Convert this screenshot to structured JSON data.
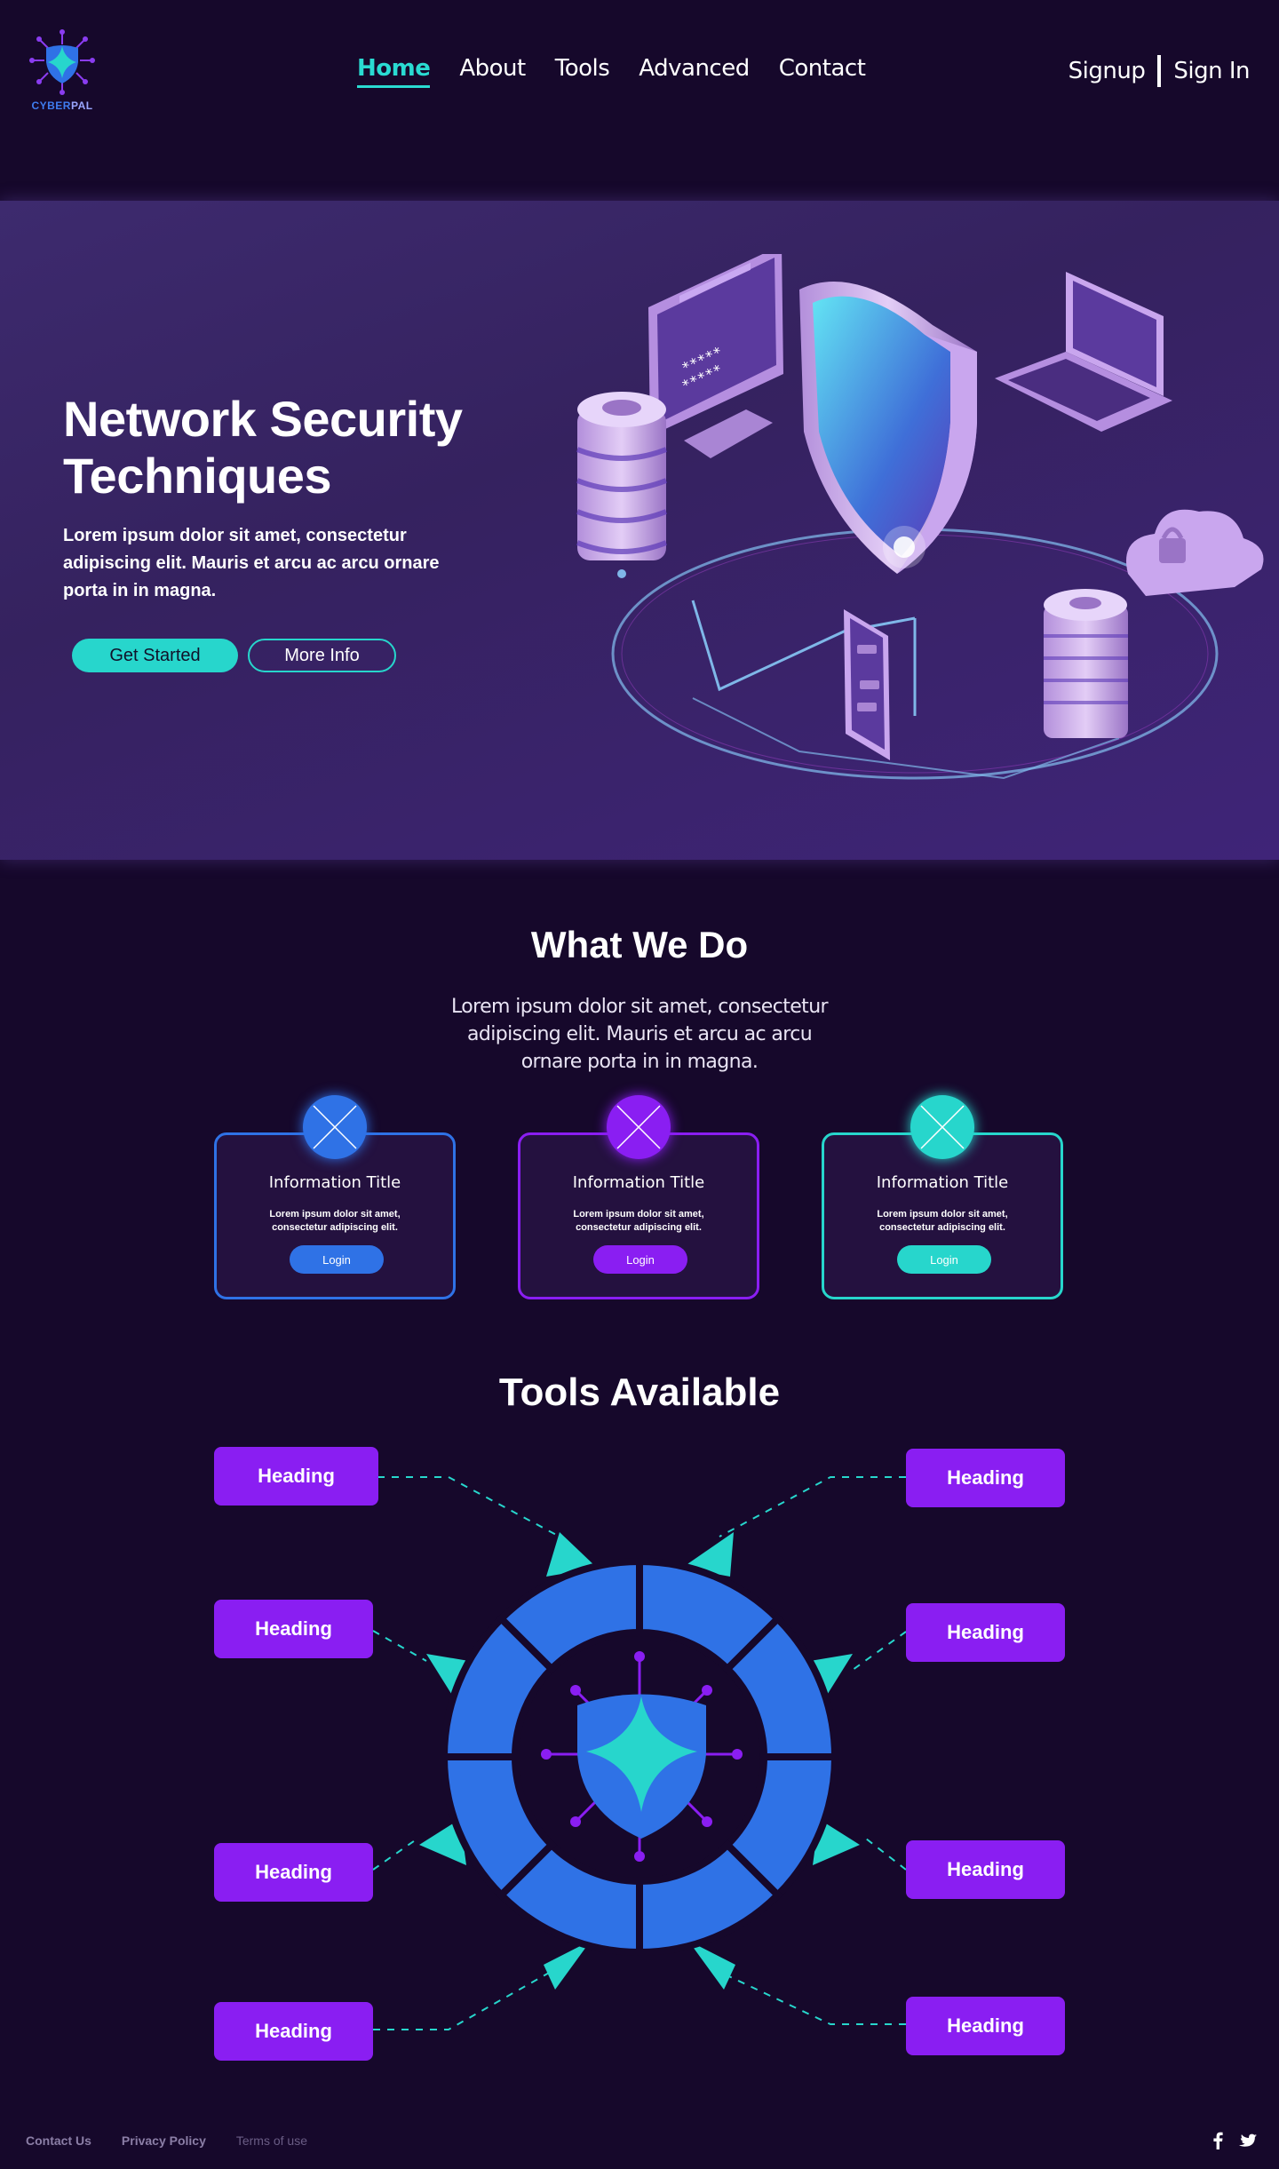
{
  "brand": {
    "logo_text_1": "CYBER",
    "logo_text_2": "PAL"
  },
  "nav": {
    "items": [
      "Home",
      "About",
      "Tools",
      "Advanced",
      "Contact"
    ],
    "active": "Home"
  },
  "auth": {
    "signup": "Signup",
    "signin": "Sign In"
  },
  "hero": {
    "title": "Network Security Techniques",
    "description": "Lorem ipsum dolor sit amet, consectetur adipiscing elit. Mauris et arcu ac arcu ornare porta in in magna.",
    "primary_button": "Get Started",
    "secondary_button": "More Info"
  },
  "what_we_do": {
    "title": "What We Do",
    "description": "Lorem ipsum dolor sit amet, consectetur adipiscing elit. Mauris et arcu ac arcu ornare porta in in magna.",
    "cards": [
      {
        "title": "Information Title",
        "text": "Lorem ipsum dolor sit amet, consectetur adipiscing elit.",
        "button": "Login",
        "color": "#2f72e6"
      },
      {
        "title": "Information Title",
        "text": "Lorem ipsum dolor sit amet, consectetur adipiscing elit.",
        "button": "Login",
        "color": "#8a1ef2"
      },
      {
        "title": "Information Title",
        "text": "Lorem ipsum dolor sit amet, consectetur adipiscing elit.",
        "button": "Login",
        "color": "#27d6cc"
      }
    ]
  },
  "tools": {
    "title": "Tools Available",
    "left_headings": [
      "Heading",
      "Heading",
      "Heading",
      "Heading"
    ],
    "right_headings": [
      "Heading",
      "Heading",
      "Heading",
      "Heading"
    ]
  },
  "footer": {
    "links": [
      "Contact Us",
      "Privacy Policy",
      "Terms of use"
    ]
  },
  "colors": {
    "background": "#16082b",
    "accent_teal": "#27d6cc",
    "accent_blue": "#2f72e6",
    "accent_purple": "#8a1ef2"
  },
  "icons": [
    "shield-logo-icon",
    "close-x-icon",
    "facebook-icon",
    "twitter-icon"
  ]
}
